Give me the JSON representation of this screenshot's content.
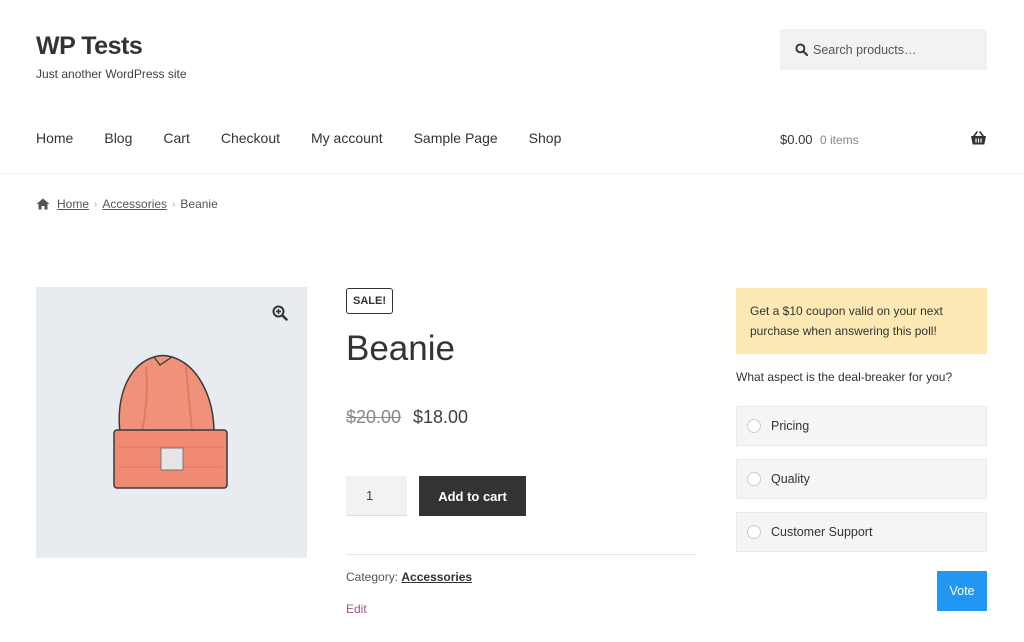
{
  "site": {
    "title": "WP Tests",
    "description": "Just another WordPress site"
  },
  "search": {
    "placeholder": "Search products…",
    "icon": "search-icon"
  },
  "nav": {
    "items": [
      "Home",
      "Blog",
      "Cart",
      "Checkout",
      "My account",
      "Sample Page",
      "Shop"
    ]
  },
  "cart": {
    "total": "$0.00",
    "count": "0 items",
    "icon": "basket-icon"
  },
  "breadcrumb": {
    "home": "Home",
    "category": "Accessories",
    "current": "Beanie"
  },
  "product": {
    "sale_badge": "SALE!",
    "title": "Beanie",
    "price_old": "$20.00",
    "price_new": "$18.00",
    "quantity": "1",
    "add_to_cart": "Add to cart",
    "category_label": "Category:",
    "category": "Accessories",
    "edit": "Edit",
    "image_color": "#f0917a"
  },
  "poll": {
    "banner": "Get a $10 coupon valid on your next purchase when answering this poll!",
    "question": "What aspect is the deal-breaker for you?",
    "options": [
      "Pricing",
      "Quality",
      "Customer Support"
    ],
    "vote": "Vote",
    "banner_color": "#fde9b3",
    "vote_color": "#2196f3"
  }
}
